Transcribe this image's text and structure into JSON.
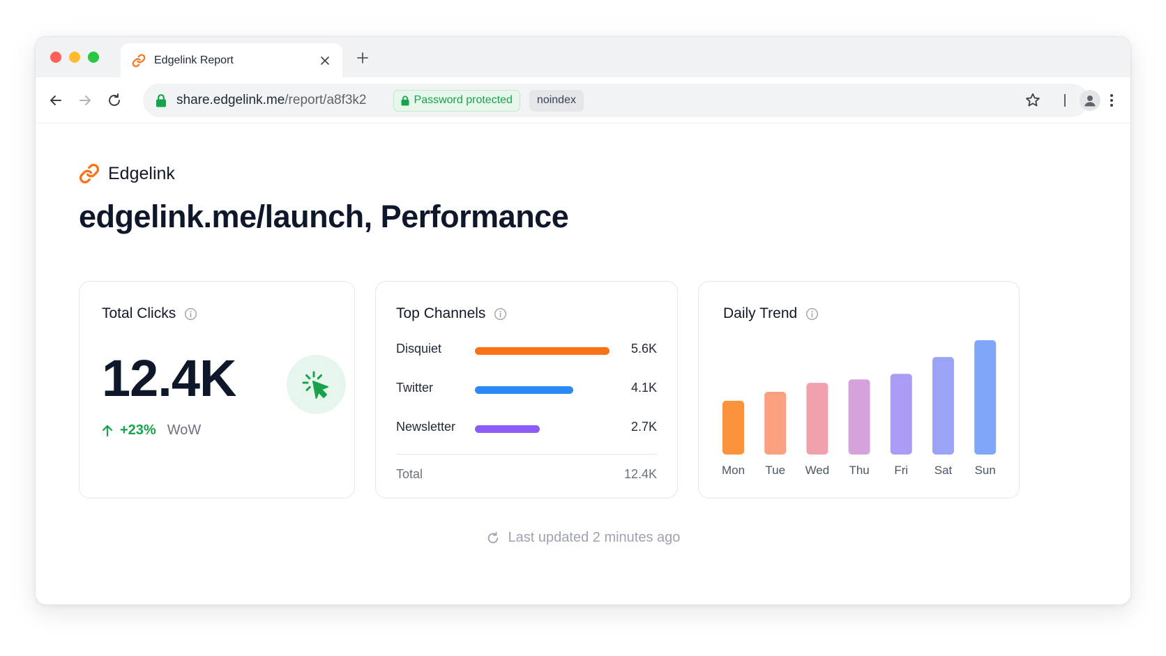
{
  "browser": {
    "tab_title": "Edgelink Report",
    "url_host": "share.edgelink.me",
    "url_path": "/report/a8f3k2",
    "badge_password": "Password protected",
    "badge_noindex": "noindex"
  },
  "brand": {
    "name": "Edgelink",
    "accent": "#f97316"
  },
  "page": {
    "title": "edgelink.me/launch, Performance"
  },
  "total_clicks": {
    "title": "Total Clicks",
    "value": "12.4K",
    "delta": "+23%",
    "delta_label": "WoW",
    "icon": "cursor-click-icon",
    "accent": "#16a34a"
  },
  "top_channels": {
    "title": "Top Channels",
    "rows": [
      {
        "name": "Disquiet",
        "value": 5.6,
        "label": "5.6K",
        "color": "#f97316"
      },
      {
        "name": "Twitter",
        "value": 4.1,
        "label": "4.1K",
        "color": "#2b8af5"
      },
      {
        "name": "Newsletter",
        "value": 2.7,
        "label": "2.7K",
        "color": "#8b5cf6"
      }
    ],
    "total_label": "Total",
    "total_value": "12.4K"
  },
  "daily_trend": {
    "title": "Daily Trend"
  },
  "chart_data": {
    "type": "bar",
    "categories": [
      "Mon",
      "Tue",
      "Wed",
      "Thu",
      "Fri",
      "Sat",
      "Sun"
    ],
    "values": [
      48,
      56,
      64,
      67,
      72,
      87,
      102
    ],
    "colors": [
      "#fb923c",
      "#fca082",
      "#f0a1ad",
      "#d5a2db",
      "#ab9bf5",
      "#9ba3f7",
      "#7fa6f9"
    ],
    "ylim": [
      0,
      102
    ],
    "grid": false,
    "legend": "none"
  },
  "footer": {
    "last_updated": "Last updated 2 minutes ago"
  }
}
